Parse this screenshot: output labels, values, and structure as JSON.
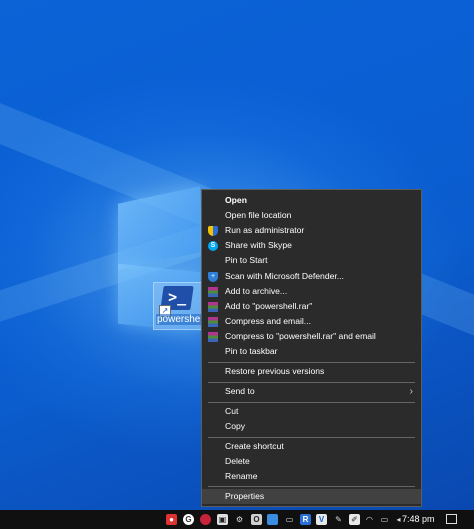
{
  "desktop": {
    "shortcut_label": "powershell"
  },
  "context_menu": {
    "items": [
      {
        "label": "Open",
        "icon": "none",
        "bold": true
      },
      {
        "label": "Open file location",
        "icon": "none"
      },
      {
        "label": "Run as administrator",
        "icon": "uac-shield-icon"
      },
      {
        "label": "Share with Skype",
        "icon": "skype-icon"
      },
      {
        "label": "Pin to Start",
        "icon": "none"
      },
      {
        "label": "Scan with Microsoft Defender...",
        "icon": "defender-shield-icon"
      },
      {
        "label": "Add to archive...",
        "icon": "winrar-icon"
      },
      {
        "label": "Add to \"powershell.rar\"",
        "icon": "winrar-icon"
      },
      {
        "label": "Compress and email...",
        "icon": "winrar-icon"
      },
      {
        "label": "Compress to \"powershell.rar\" and email",
        "icon": "winrar-icon"
      },
      {
        "label": "Pin to taskbar",
        "icon": "none"
      },
      {
        "label": "Restore previous versions",
        "icon": "none"
      },
      {
        "label": "Send to",
        "icon": "none",
        "submenu": true
      },
      {
        "label": "Cut",
        "icon": "none"
      },
      {
        "label": "Copy",
        "icon": "none"
      },
      {
        "label": "Create shortcut",
        "icon": "none"
      },
      {
        "label": "Delete",
        "icon": "none"
      },
      {
        "label": "Rename",
        "icon": "none"
      },
      {
        "label": "Properties",
        "icon": "none",
        "highlighted": true
      }
    ]
  },
  "taskbar": {
    "tray_icons": [
      "record-icon",
      "google-icon",
      "app-icon",
      "screenshot-icon",
      "gear-icon",
      "office-icon",
      "clipboard-icon",
      "wifi-extender-icon",
      "r-icon",
      "teamviewer-icon",
      "v-icon",
      "pen-icon",
      "wifi-icon",
      "battery-icon",
      "volume-icon"
    ],
    "time": "7:48 pm"
  },
  "colors": {
    "menu_background": "#2b2b2b",
    "menu_hover": "#414141",
    "desktop_blue": "#0a5fd3",
    "taskbar": "#101010"
  }
}
